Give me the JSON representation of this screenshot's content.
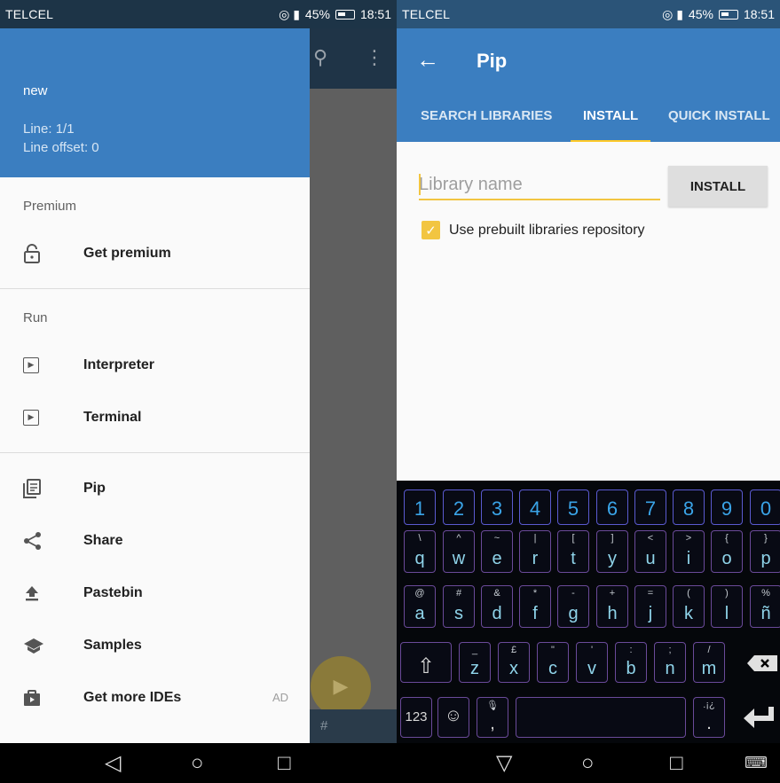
{
  "left_screen": {
    "status": {
      "carrier": "TELCEL",
      "battery": "45%",
      "time": "18:51"
    },
    "drawer": {
      "file_name": "new",
      "line": "Line: 1/1",
      "line_offset": "Line offset: 0",
      "section_premium": "Premium",
      "get_premium": "Get premium",
      "section_run": "Run",
      "interpreter": "Interpreter",
      "terminal": "Terminal",
      "pip": "Pip",
      "share": "Share",
      "pastebin": "Pastebin",
      "samples": "Samples",
      "get_more_ides": "Get more IDEs",
      "ad_badge": "AD"
    },
    "bottom_hint": "#"
  },
  "right_screen": {
    "status": {
      "carrier": "TELCEL",
      "battery": "45%",
      "time": "18:51"
    },
    "title": "Pip",
    "tabs": [
      "SEARCH LIBRARIES",
      "INSTALL",
      "QUICK INSTALL"
    ],
    "active_tab": "INSTALL",
    "library_placeholder": "Library name",
    "install_button": "INSTALL",
    "prebuilt_label": "Use prebuilt libraries repository",
    "prebuilt_checked": true
  },
  "keyboard": {
    "numbers": [
      "1",
      "2",
      "3",
      "4",
      "5",
      "6",
      "7",
      "8",
      "9",
      "0"
    ],
    "row1": [
      {
        "main": "q",
        "sub": "\\"
      },
      {
        "main": "w",
        "sub": "^"
      },
      {
        "main": "e",
        "sub": "~"
      },
      {
        "main": "r",
        "sub": "|"
      },
      {
        "main": "t",
        "sub": "["
      },
      {
        "main": "y",
        "sub": "]"
      },
      {
        "main": "u",
        "sub": "<"
      },
      {
        "main": "i",
        "sub": ">"
      },
      {
        "main": "o",
        "sub": "{"
      },
      {
        "main": "p",
        "sub": "}"
      }
    ],
    "row2": [
      {
        "main": "a",
        "sub": "@"
      },
      {
        "main": "s",
        "sub": "#"
      },
      {
        "main": "d",
        "sub": "&"
      },
      {
        "main": "f",
        "sub": "*"
      },
      {
        "main": "g",
        "sub": "-"
      },
      {
        "main": "h",
        "sub": "+"
      },
      {
        "main": "j",
        "sub": "="
      },
      {
        "main": "k",
        "sub": "("
      },
      {
        "main": "l",
        "sub": ")"
      },
      {
        "main": "ñ",
        "sub": "%"
      }
    ],
    "row3": [
      {
        "main": "z",
        "sub": "_"
      },
      {
        "main": "x",
        "sub": "£"
      },
      {
        "main": "c",
        "sub": "\""
      },
      {
        "main": "v",
        "sub": "'"
      },
      {
        "main": "b",
        "sub": ":"
      },
      {
        "main": "n",
        "sub": ";"
      },
      {
        "main": "m",
        "sub": "/"
      }
    ],
    "symbols_key": "123",
    "comma_key": ",",
    "period_key": ".",
    "period_sub": ".¡¿"
  },
  "colors": {
    "primary": "#3b7ec0",
    "accent": "#f2c541",
    "dark_primary": "#2b5478"
  }
}
